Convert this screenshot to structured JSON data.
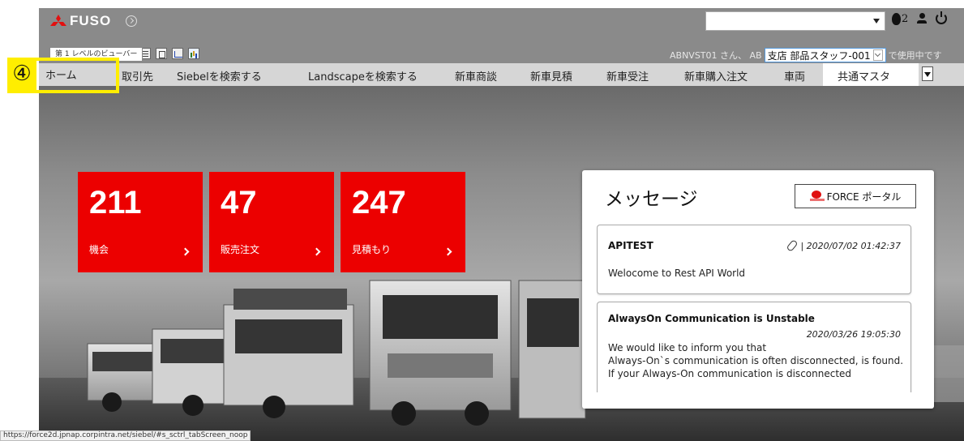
{
  "header": {
    "logo_text": "FUSO",
    "notification_count": "2"
  },
  "toolbar": {
    "tooltip": "第 1 レベルのビューバー",
    "user_prefix": "ABNVST01 さん、 AB",
    "store_value": "支店 部品スタッフ-001",
    "user_suffix": "で使用中です"
  },
  "nav": {
    "tabs": [
      "ホーム",
      "取引先",
      "Siebelを検索する",
      "Landscapeを検索する",
      "新車商談",
      "新車見積",
      "新車受注",
      "新車購入注文",
      "車両",
      "共通マスタ"
    ]
  },
  "annotation": {
    "badge": "④"
  },
  "kpis": [
    {
      "value": "211",
      "label": "機会"
    },
    {
      "value": "47",
      "label": "販売注文"
    },
    {
      "value": "247",
      "label": "見積もり"
    }
  ],
  "messages": {
    "title": "メッセージ",
    "portal_button": "FORCE ポータル",
    "items": [
      {
        "title": "APITEST",
        "date": "| 2020/07/02 01:42:37",
        "body": "Welocome to Rest API World"
      },
      {
        "title": "AlwaysOn Communication is Unstable",
        "date": "2020/03/26 19:05:30",
        "body": "We would like to inform you that\nAlways-On`s communication is often disconnected, is found. If your Always-On communication is disconnected"
      }
    ]
  },
  "status_bar": "https://force2d.jpnap.corpintra.net/siebel/#s_sctrl_tabScreen_noop",
  "colors": {
    "kpi_red": "#ec0000",
    "annotation_yellow": "#ffee00",
    "header_gray": "#8a8a8a"
  }
}
